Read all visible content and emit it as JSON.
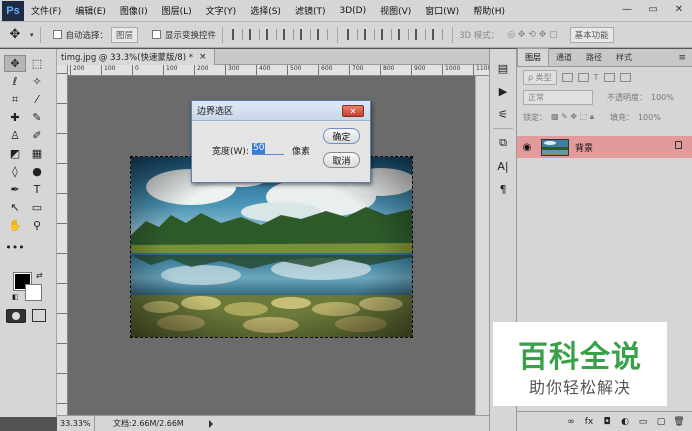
{
  "app": {
    "logo": "Ps",
    "menu": [
      "文件(F)",
      "编辑(E)",
      "图像(I)",
      "图层(L)",
      "文字(Y)",
      "选择(S)",
      "滤镜(T)",
      "3D(D)",
      "视图(V)",
      "窗口(W)",
      "帮助(H)"
    ],
    "window_controls": [
      "—",
      "▭",
      "✕"
    ]
  },
  "options": {
    "auto_select_label": "自动选择：",
    "auto_select_value": "图层",
    "show_transform_label": "显示变换控件",
    "mode_3d_label": "3D 模式：",
    "workspace_value": "基本功能"
  },
  "document": {
    "tab_title": "timg.jpg @ 33.3%(快速蒙版/8) *",
    "close_glyph": "×",
    "ruler_labels": [
      "200",
      "100",
      "0",
      "100",
      "200",
      "300",
      "400",
      "500",
      "600",
      "700",
      "800",
      "900",
      "1000",
      "1100"
    ],
    "zoom": "33.33%",
    "doc_info": "文档:2.66M/2.66M"
  },
  "dialog": {
    "title": "边界选区",
    "close_glyph": "✕",
    "width_label": "宽度(W):",
    "width_value": "50",
    "unit": "像素",
    "ok_label": "确定",
    "cancel_label": "取消"
  },
  "layers_panel": {
    "tabs": [
      "图层",
      "通道",
      "路径",
      "样式"
    ],
    "kind_filter": "ρ 类型",
    "blend_mode": "正常",
    "opacity_label": "不透明度：",
    "opacity_value": "100%",
    "lock_label": "锁定：",
    "fill_label": "填充：",
    "fill_value": "100%",
    "layer_name": "背景",
    "bottom_icons": [
      "link-icon",
      "fx-icon",
      "mask-icon",
      "adjustment-icon",
      "group-icon",
      "new-layer-icon",
      "trash-icon"
    ]
  },
  "watermark": {
    "title": "百科全说",
    "subtitle": "助你轻松解决"
  },
  "colors": {
    "foreground": "#000000",
    "background": "#ffffff",
    "selected_layer": "#e39a9a",
    "watermark_green": "#3aa14a"
  }
}
